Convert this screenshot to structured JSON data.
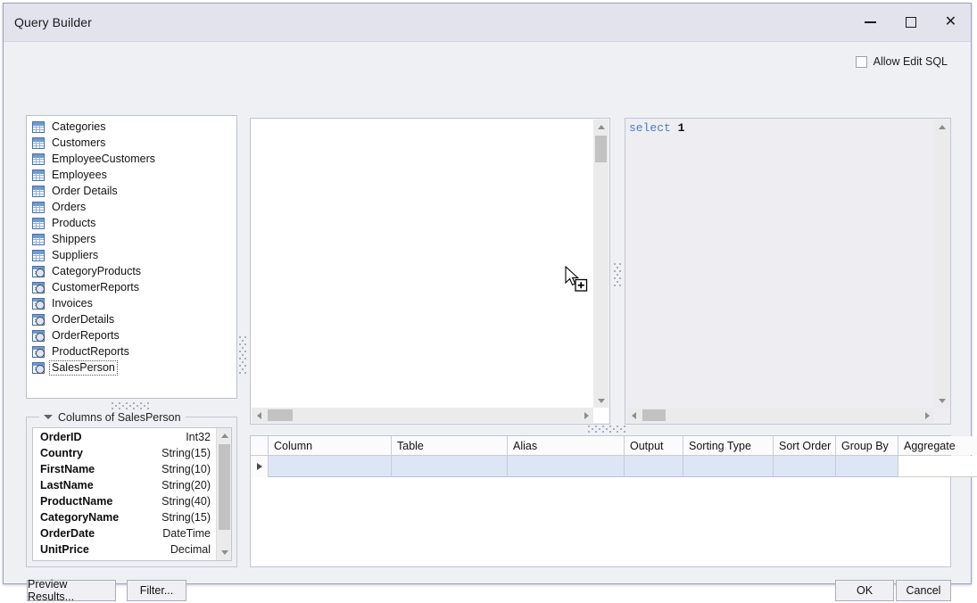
{
  "window": {
    "title": "Query Builder",
    "minimize_label": "Minimize",
    "maximize_label": "Maximize",
    "close_label": "Close"
  },
  "options": {
    "allow_edit_sql_label": "Allow Edit SQL",
    "allow_edit_sql_checked": false
  },
  "tables_list": {
    "items": [
      {
        "label": "Categories",
        "icon": "table-icon",
        "type": "table",
        "focused": false
      },
      {
        "label": "Customers",
        "icon": "table-icon",
        "type": "table",
        "focused": false
      },
      {
        "label": "EmployeeCustomers",
        "icon": "table-icon",
        "type": "table",
        "focused": false
      },
      {
        "label": "Employees",
        "icon": "table-icon",
        "type": "table",
        "focused": false
      },
      {
        "label": "Order Details",
        "icon": "table-icon",
        "type": "table",
        "focused": false
      },
      {
        "label": "Orders",
        "icon": "table-icon",
        "type": "table",
        "focused": false
      },
      {
        "label": "Products",
        "icon": "table-icon",
        "type": "table",
        "focused": false
      },
      {
        "label": "Shippers",
        "icon": "table-icon",
        "type": "table",
        "focused": false
      },
      {
        "label": "Suppliers",
        "icon": "table-icon",
        "type": "table",
        "focused": false
      },
      {
        "label": "CategoryProducts",
        "icon": "view-icon",
        "type": "view",
        "focused": false
      },
      {
        "label": "CustomerReports",
        "icon": "view-icon",
        "type": "view",
        "focused": false
      },
      {
        "label": "Invoices",
        "icon": "view-icon",
        "type": "view",
        "focused": false
      },
      {
        "label": "OrderDetails",
        "icon": "view-icon",
        "type": "view",
        "focused": false
      },
      {
        "label": "OrderReports",
        "icon": "view-icon",
        "type": "view",
        "focused": false
      },
      {
        "label": "ProductReports",
        "icon": "view-icon",
        "type": "view",
        "focused": false
      },
      {
        "label": "SalesPerson",
        "icon": "view-icon",
        "type": "view",
        "focused": true
      }
    ]
  },
  "columns_panel": {
    "caption": "Columns of SalesPerson",
    "expanded": true,
    "rows": [
      {
        "name": "OrderID",
        "type": "Int32"
      },
      {
        "name": "Country",
        "type": "String(15)"
      },
      {
        "name": "FirstName",
        "type": "String(10)"
      },
      {
        "name": "LastName",
        "type": "String(20)"
      },
      {
        "name": "ProductName",
        "type": "String(40)"
      },
      {
        "name": "CategoryName",
        "type": "String(15)"
      },
      {
        "name": "OrderDate",
        "type": "DateTime"
      },
      {
        "name": "UnitPrice",
        "type": "Decimal"
      }
    ]
  },
  "sql_editor": {
    "keyword": "select",
    "literal": "1",
    "full_text": "select 1"
  },
  "criteria_grid": {
    "headers": [
      "Column",
      "Table",
      "Alias",
      "Output",
      "Sorting Type",
      "Sort Order",
      "Group By",
      "Aggregate"
    ],
    "rows": [
      {
        "Column": "",
        "Table": "",
        "Alias": "",
        "Output": "",
        "Sorting Type": "",
        "Sort Order": "",
        "Group By": "",
        "Aggregate": "",
        "selected": true
      }
    ]
  },
  "footer": {
    "preview_label": "Preview Results...",
    "filter_label": "Filter...",
    "ok_label": "OK",
    "cancel_label": "Cancel"
  },
  "colors": {
    "window_bg": "#eff0f4",
    "titlebar_bg": "#e2e3ed",
    "border": "#9ea3bd",
    "selection_blue": "#dce6f4",
    "sql_keyword": "#4a7ebb",
    "canvas_white": "#ffffff"
  }
}
